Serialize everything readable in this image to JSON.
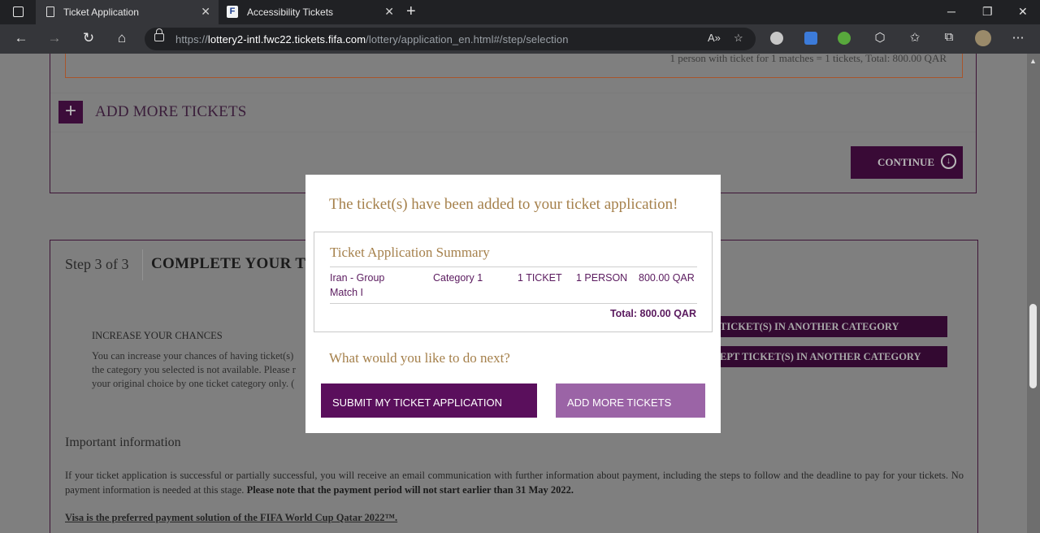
{
  "browser": {
    "tabs": [
      {
        "title": "Ticket Application",
        "active": true
      },
      {
        "title": "Accessibility Tickets",
        "active": false
      }
    ],
    "url_prefix": "https://",
    "url_domain": "lottery2-intl.fwc22.tickets.fifa.com",
    "url_path": "/lottery/application_en.html#/step/selection"
  },
  "page": {
    "selection_summary": "1 person with ticket for 1 matches = 1 tickets, Total: 800.00 QAR",
    "add_more_plus": "+",
    "add_more_label": "ADD MORE TICKETS",
    "continue_label": "CONTINUE",
    "step_label": "Step 3 of 3",
    "step_title": "COMPLETE YOUR T",
    "increase_title": "INCREASE YOUR CHANCES",
    "increase_text_lines": [
      "You can increase your chances of having ticket(s)",
      "the category you selected is not available. Please r",
      "your original choice by one ticket category only. ("
    ],
    "category_buttons": [
      "TICKET(S) IN ANOTHER CATEGORY",
      "EPT TICKET(S) IN ANOTHER CATEGORY"
    ],
    "important_title": "Important information",
    "important_text": "If your ticket application is successful or partially successful, you will receive an email communication with further information about payment, including the steps to follow and the deadline to pay for your tickets. No payment information is needed at this stage.",
    "important_bold": "Please note that the payment period will not start earlier than 31 May 2022.",
    "visa_text": "Visa is the preferred payment solution of the FIFA World Cup Qatar 2022™."
  },
  "modal": {
    "heading": "The ticket(s) have been added to your ticket application!",
    "summary_title": "Ticket Application Summary",
    "row": {
      "match_line1": "Iran - Group",
      "match_line2": "Match I",
      "category": "Category 1",
      "tickets": "1 TICKET",
      "persons": "1 PERSON",
      "price": "800.00 QAR"
    },
    "total": "Total: 800.00 QAR",
    "next_question": "What would you like to do next?",
    "submit_label": "SUBMIT MY TICKET APPLICATION",
    "add_more_label": "ADD MORE TICKETS"
  },
  "colors": {
    "accent_purple": "#5a0f5c",
    "light_purple": "#9b64a6",
    "gold_text": "#a5804b"
  }
}
